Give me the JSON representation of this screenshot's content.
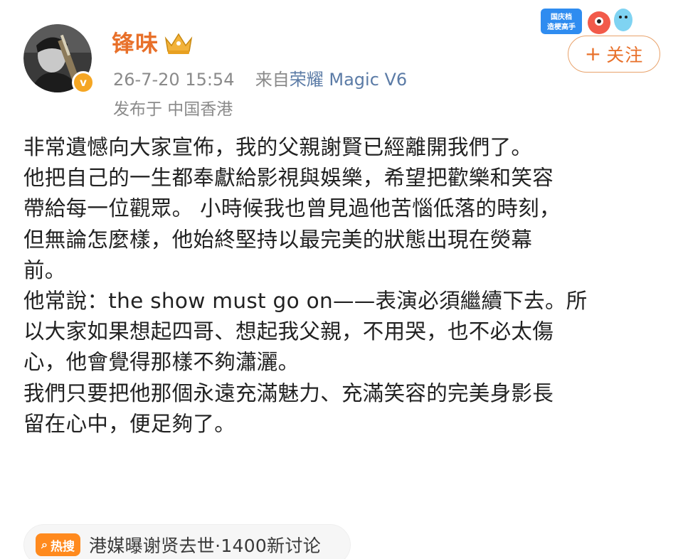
{
  "header": {
    "username": "锋味",
    "timestamp": "26-7-20 15:54",
    "source_prefix": "来自",
    "source_device": "荣耀 Magic V6",
    "location": "发布于 中国香港",
    "follow_label": "关注",
    "follow_plus": "+",
    "sticker_text": "国庆档\n造梗高手"
  },
  "post": {
    "paragraphs": [
      "非常遺憾向大家宣佈，我的父親謝賢已經離開我們了。",
      "他把自己的一生都奉獻給影視與娛樂，希望把歡樂和笑容\n帶給每一位觀眾。 小時候我也曾見過他苦惱低落的時刻，\n但無論怎麼樣，他始終堅持以最完美的狀態出現在熒幕\n前。",
      "他常說：the show must go on——表演必須繼續下去。所\n以大家如果想起四哥、想起我父親，不用哭，也不必太傷\n心，他會覺得那樣不夠瀟灑。",
      "我們只要把他那個永遠充滿魅力、充滿笑容的完美身影長\n留在心中，便足夠了。"
    ]
  },
  "hot_search": {
    "tag_label": "热搜",
    "tag_icon": "search-icon",
    "text": "港媒曝谢贤去世·1400新讨论"
  },
  "colors": {
    "accent": "#e8702a",
    "meta": "#8a8a8a",
    "source_link": "#5b7ba6",
    "hot_tag": "#ff8a1e",
    "verified": "#f5a623"
  }
}
